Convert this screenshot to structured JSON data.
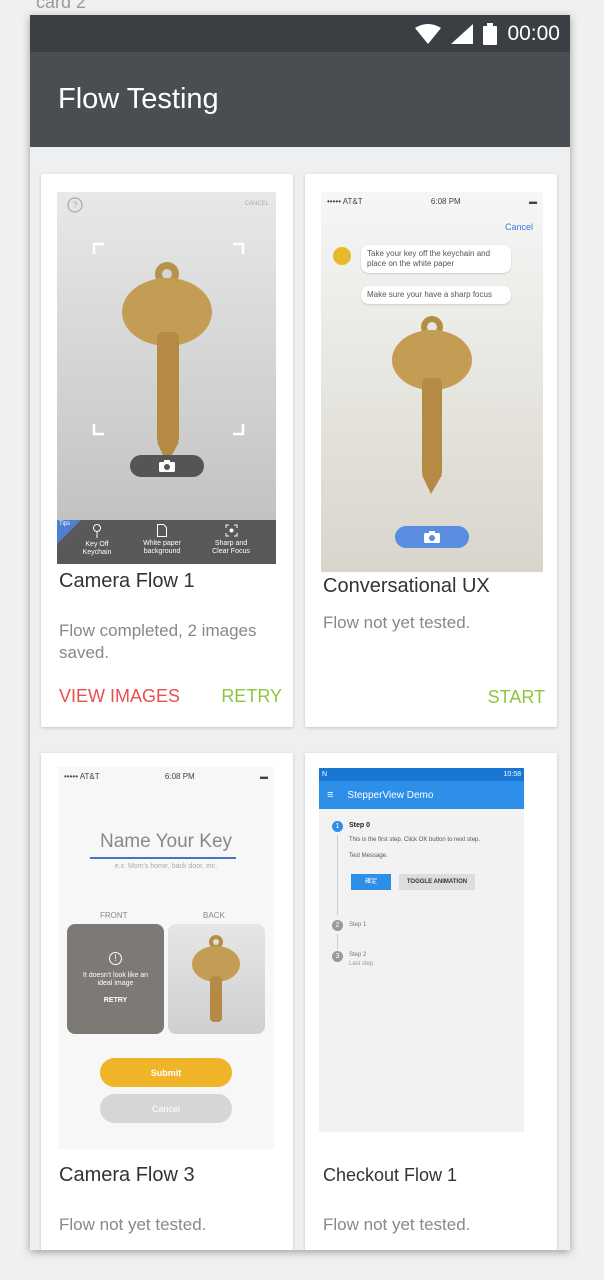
{
  "caption": "card 2",
  "status_bar": {
    "time": "00:00"
  },
  "app_bar": {
    "title": "Flow Testing"
  },
  "cards": [
    {
      "title": "Camera Flow 1",
      "status": "Flow completed, 2 images saved.",
      "actions": [
        "VIEW IMAGES",
        "RETRY"
      ],
      "thumbnail": {
        "cancel": "CANCEL",
        "tips": "Tips",
        "tip_items": [
          "Key Off Keychain",
          "White paper background",
          "Sharp and Clear Focus"
        ]
      }
    },
    {
      "title": "Conversational UX",
      "status": "Flow not yet tested.",
      "actions": [
        "START"
      ],
      "thumbnail": {
        "carrier": "••••• AT&T",
        "time": "6:08 PM",
        "cancel": "Cancel",
        "bubble1": "Take your key off the keychain and place on the white paper",
        "bubble2": "Make sure your have a sharp focus"
      }
    },
    {
      "title": "Camera Flow 3",
      "status": "Flow not yet tested.",
      "thumbnail": {
        "carrier": "••••• AT&T",
        "time": "6:08 PM",
        "heading": "Name Your Key",
        "hint": "e.x. Mom's home, back door, etc.",
        "front": "FRONT",
        "back": "BACK",
        "warning": "It doesn't look like an ideal image",
        "retry": "RETRY",
        "submit": "Submit",
        "cancel": "Cancel"
      }
    },
    {
      "title": "Checkout Flow 1",
      "status": "Flow not yet tested.",
      "thumbnail": {
        "time": "10:58",
        "app_title": "StepperView Demo",
        "step0_title": "Step 0",
        "step0_text": "This is the first step. Click OK button to next step.",
        "step0_msg": "Test Message.",
        "ok": "確定",
        "toggle": "TOGGLE ANIMATION",
        "step1_title": "Step 1",
        "step2_title": "Step 2",
        "step2_sub": "Last step"
      }
    }
  ],
  "colors": {
    "appbar": "#4a4e53",
    "statusbar": "#3b3f43",
    "danger": "#e8504a",
    "success": "#8cc63f",
    "stepper_blue": "#2e8fe8"
  }
}
